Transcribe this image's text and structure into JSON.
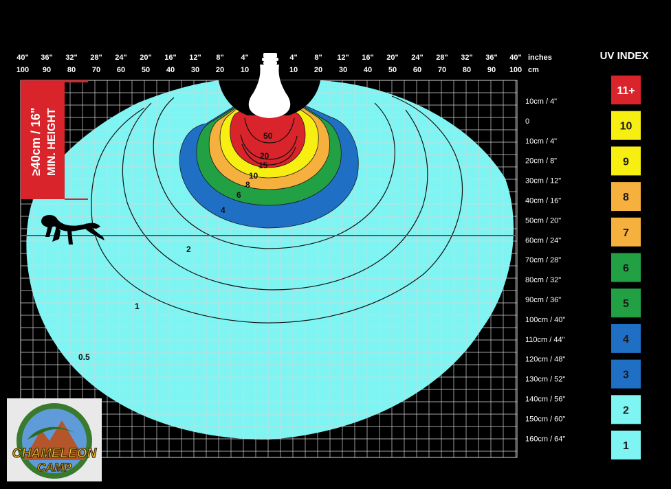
{
  "colors": {
    "background": "#000000",
    "grid_line": "#d6d6d6",
    "zone_light": "#7ef5f3",
    "zone_blue": "#1f6fc4",
    "zone_green": "#22a144",
    "zone_orange": "#f6b03e",
    "zone_yellow": "#f7ef12",
    "zone_red": "#d8242a",
    "min_height_red": "#d8242a",
    "basking_line": "#e0202a"
  },
  "top_axis": {
    "inches_left": [
      "40\"",
      "36\"",
      "32\"",
      "28\"",
      "24\"",
      "20\"",
      "16\"",
      "12\"",
      "8\"",
      "4\""
    ],
    "inches_right": [
      "4\"",
      "8\"",
      "12\"",
      "16\"",
      "20\"",
      "24\"",
      "28\"",
      "32\"",
      "36\"",
      "40\""
    ],
    "inches_unit": "inches",
    "cm_left": [
      "100",
      "90",
      "80",
      "70",
      "60",
      "50",
      "40",
      "30",
      "20",
      "10"
    ],
    "cm_right": [
      "10",
      "20",
      "30",
      "40",
      "50",
      "60",
      "70",
      "80",
      "90",
      "100"
    ],
    "cm_unit": "cm"
  },
  "right_axis": {
    "labels": [
      "10cm / 4\"",
      "0",
      "10cm / 4\"",
      "20cm / 8\"",
      "30cm / 12\"",
      "40cm / 16\"",
      "50cm / 20\"",
      "60cm / 24\"",
      "70cm / 28\"",
      "80cm / 32\"",
      "90cm / 36\"",
      "100cm / 40\"",
      "110cm / 44\"",
      "120cm / 48\"",
      "130cm / 52\"",
      "140cm / 56\"",
      "150cm / 60\"",
      "160cm / 64\""
    ]
  },
  "min_height": {
    "line1": "≥40cm / 16\"",
    "line2": "MIN. HEIGHT"
  },
  "contours": [
    "50",
    "20",
    "15",
    "10",
    "8",
    "6",
    "4",
    "2",
    "1",
    "0.5"
  ],
  "legend": {
    "title": "UV INDEX",
    "items": [
      {
        "label": "11+",
        "color": "#d8242a",
        "text_color": "#ffffff"
      },
      {
        "label": "10",
        "color": "#f7ef12",
        "text_color": "#1a1a1a"
      },
      {
        "label": "9",
        "color": "#f7ef12",
        "text_color": "#1a1a1a"
      },
      {
        "label": "8",
        "color": "#f6b03e",
        "text_color": "#1a1a1a"
      },
      {
        "label": "7",
        "color": "#f6b03e",
        "text_color": "#1a1a1a"
      },
      {
        "label": "6",
        "color": "#22a144",
        "text_color": "#1a1a1a"
      },
      {
        "label": "5",
        "color": "#22a144",
        "text_color": "#1a1a1a"
      },
      {
        "label": "4",
        "color": "#1f6fc4",
        "text_color": "#1a1a1a"
      },
      {
        "label": "3",
        "color": "#1f6fc4",
        "text_color": "#1a1a1a"
      },
      {
        "label": "2",
        "color": "#7ef5f3",
        "text_color": "#1a1a1a"
      },
      {
        "label": "1",
        "color": "#7ef5f3",
        "text_color": "#1a1a1a"
      }
    ]
  },
  "logo": {
    "line1": "CHAMELEON",
    "line2": "CAMP"
  }
}
